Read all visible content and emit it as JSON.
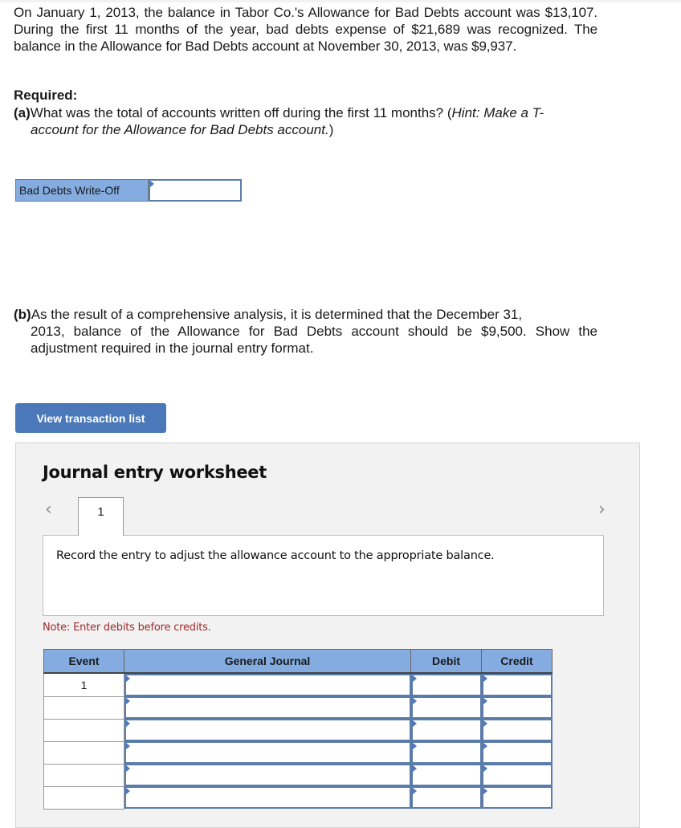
{
  "problem": {
    "intro": "On January 1, 2013, the balance in Tabor Co.'s Allowance for Bad Debts account was $13,107. During the first 11 months of the year, bad debts expense of $21,689 was recognized. The balance in the Allowance for Bad Debts account at November 30, 2013, was $9,937.",
    "required_label": "Required:",
    "part_a": {
      "label": "(a)",
      "text_first": "What was the total of accounts written off during the first 11 months? (",
      "hint": "Hint: Make a T-",
      "text_indent_italic": "account for the Allowance for Bad Debts account.",
      "text_end": ")"
    },
    "part_b": {
      "label": "(b)",
      "text_first": "As the result of a comprehensive analysis, it is determined that the December 31,",
      "text_rest": "2013, balance of the Allowance for Bad Debts account should be $9,500. Show the adjustment required in the journal entry format."
    }
  },
  "answer_a": {
    "label": "Bad Debts Write-Off",
    "value": ""
  },
  "buttons": {
    "view_transaction_list": "View transaction list"
  },
  "worksheet": {
    "title": "Journal entry worksheet",
    "prev_icon": "‹",
    "next_icon": "›",
    "tabs": [
      {
        "label": "1"
      }
    ],
    "instruction": "Record the entry to adjust the allowance account to the appropriate balance.",
    "note": "Note: Enter debits before credits.",
    "table": {
      "headers": [
        "Event",
        "General Journal",
        "Debit",
        "Credit"
      ],
      "rows": [
        {
          "event": "1",
          "account": "",
          "debit": "",
          "credit": ""
        },
        {
          "event": "",
          "account": "",
          "debit": "",
          "credit": ""
        },
        {
          "event": "",
          "account": "",
          "debit": "",
          "credit": ""
        },
        {
          "event": "",
          "account": "",
          "debit": "",
          "credit": ""
        },
        {
          "event": "",
          "account": "",
          "debit": "",
          "credit": ""
        },
        {
          "event": "",
          "account": "",
          "debit": "",
          "credit": ""
        }
      ]
    }
  },
  "colors": {
    "header_blue": "#84ace0",
    "button_blue": "#4a78b8",
    "input_border": "#5b7cab",
    "note_red": "#a52a2a",
    "panel_gray": "#f2f2f2"
  }
}
